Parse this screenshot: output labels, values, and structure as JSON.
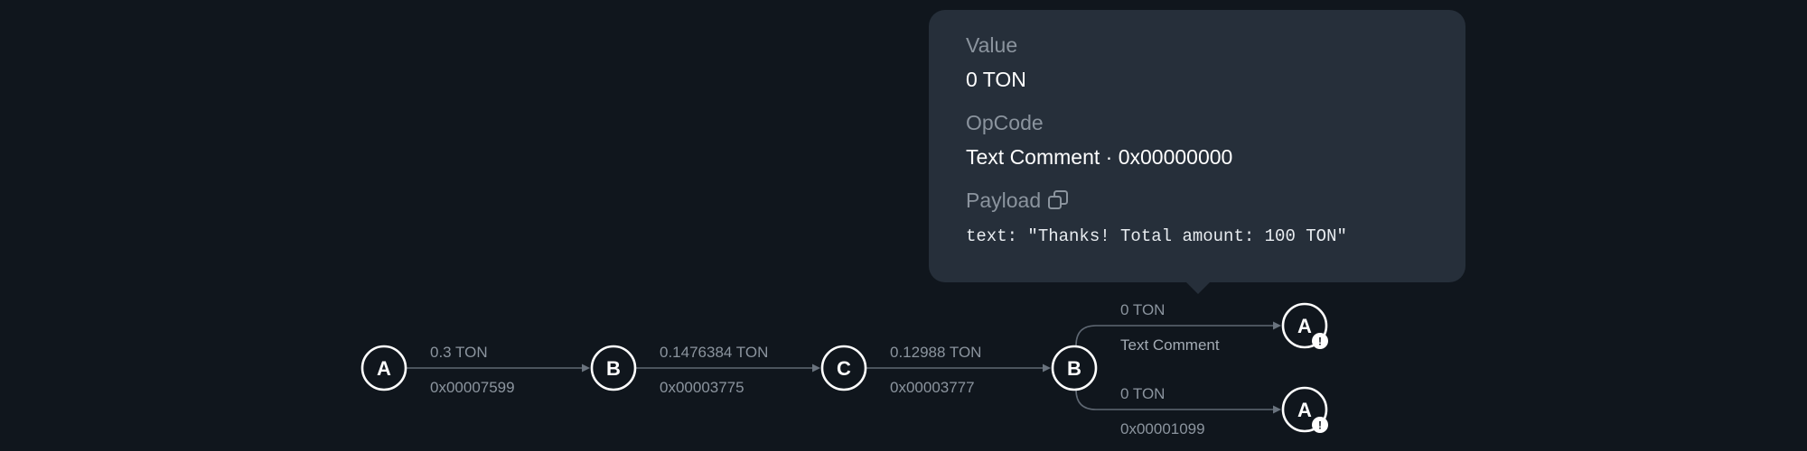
{
  "graph": {
    "nodes": [
      {
        "id": "n1",
        "label": "A",
        "warning": false
      },
      {
        "id": "n2",
        "label": "B",
        "warning": false
      },
      {
        "id": "n3",
        "label": "C",
        "warning": false
      },
      {
        "id": "n4",
        "label": "B",
        "warning": false
      },
      {
        "id": "n5",
        "label": "A",
        "warning": true
      },
      {
        "id": "n6",
        "label": "A",
        "warning": true
      }
    ],
    "edges": [
      {
        "from": "n1",
        "to": "n2",
        "value": "0.3 TON",
        "opcode": "0x00007599"
      },
      {
        "from": "n2",
        "to": "n3",
        "value": "0.1476384 TON",
        "opcode": "0x00003775"
      },
      {
        "from": "n3",
        "to": "n4",
        "value": "0.12988 TON",
        "opcode": "0x00003777"
      },
      {
        "from": "n4",
        "to": "n5",
        "value": "0 TON",
        "opcode": "Text Comment"
      },
      {
        "from": "n4",
        "to": "n6",
        "value": "0 TON",
        "opcode": "0x00001099"
      }
    ]
  },
  "tooltip": {
    "value_label": "Value",
    "value": "0 TON",
    "opcode_label": "OpCode",
    "opcode": "Text Comment · 0x00000000",
    "payload_label": "Payload",
    "payload_icon": "copy-icon",
    "payload_text": "text: \"Thanks! Total amount: 100 TON\""
  },
  "colors": {
    "background": "#10161d",
    "tooltip_background": "#262f3a",
    "node_stroke": "#ffffff",
    "edge": "#5f6873",
    "muted_text": "#8b949e"
  }
}
